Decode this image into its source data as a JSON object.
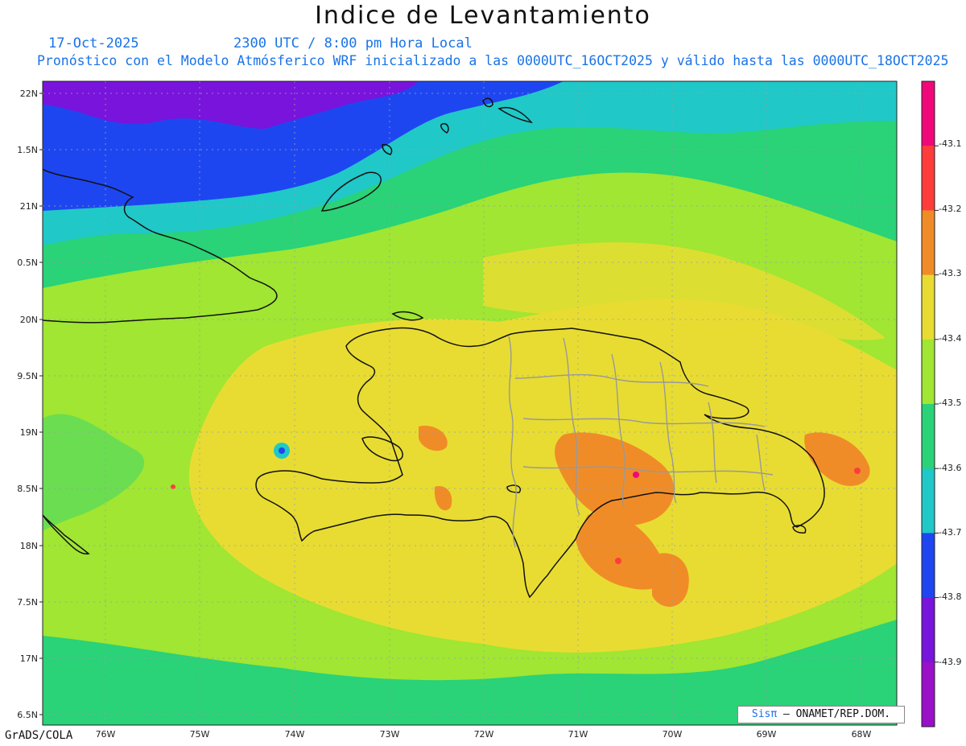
{
  "header": {
    "title": "Indice de Levantamiento",
    "date": "17-Oct-2025",
    "time": "2300 UTC / 8:00 pm Hora Local",
    "model": "Pronóstico con el Modelo Atmósferico WRF inicializado a las 0000UTC_16OCT2025 y válido hasta las  0000UTC_18OCT2025"
  },
  "axes": {
    "lat_labels": [
      "22N",
      "1.5N",
      "21N",
      "0.5N",
      "20N",
      "9.5N",
      "19N",
      "8.5N",
      "18N",
      "7.5N",
      "17N",
      "6.5N"
    ],
    "lon_labels": [
      "76W",
      "75W",
      "74W",
      "73W",
      "72W",
      "71W",
      "70W",
      "69W",
      "68W"
    ]
  },
  "legend": {
    "labels": [
      "-43.1",
      "-43.2",
      "-43.3",
      "-43.4",
      "-43.5",
      "-43.6",
      "-43.7",
      "-43.8",
      "-43.9"
    ],
    "colors": [
      "#f0087a",
      "#ff3c3c",
      "#f08c28",
      "#e8dc32",
      "#a0e632",
      "#2ad278",
      "#20c8c8",
      "#1e46f0",
      "#7814dc",
      "#9a10c8"
    ]
  },
  "footer": {
    "grads": "GrADS/COLA",
    "credit_brand": "Sisπ",
    "credit_text": "– ONAMET/REP.DOM."
  },
  "map": {
    "palette": {
      "purple": "#7814dc",
      "blue": "#1e46f0",
      "cyan": "#20c8c8",
      "green": "#2ad278",
      "lime": "#a0e632",
      "yellow": "#e8dc32",
      "orange": "#f08c28",
      "red": "#ff3c3c",
      "magenta": "#f0087a"
    }
  }
}
